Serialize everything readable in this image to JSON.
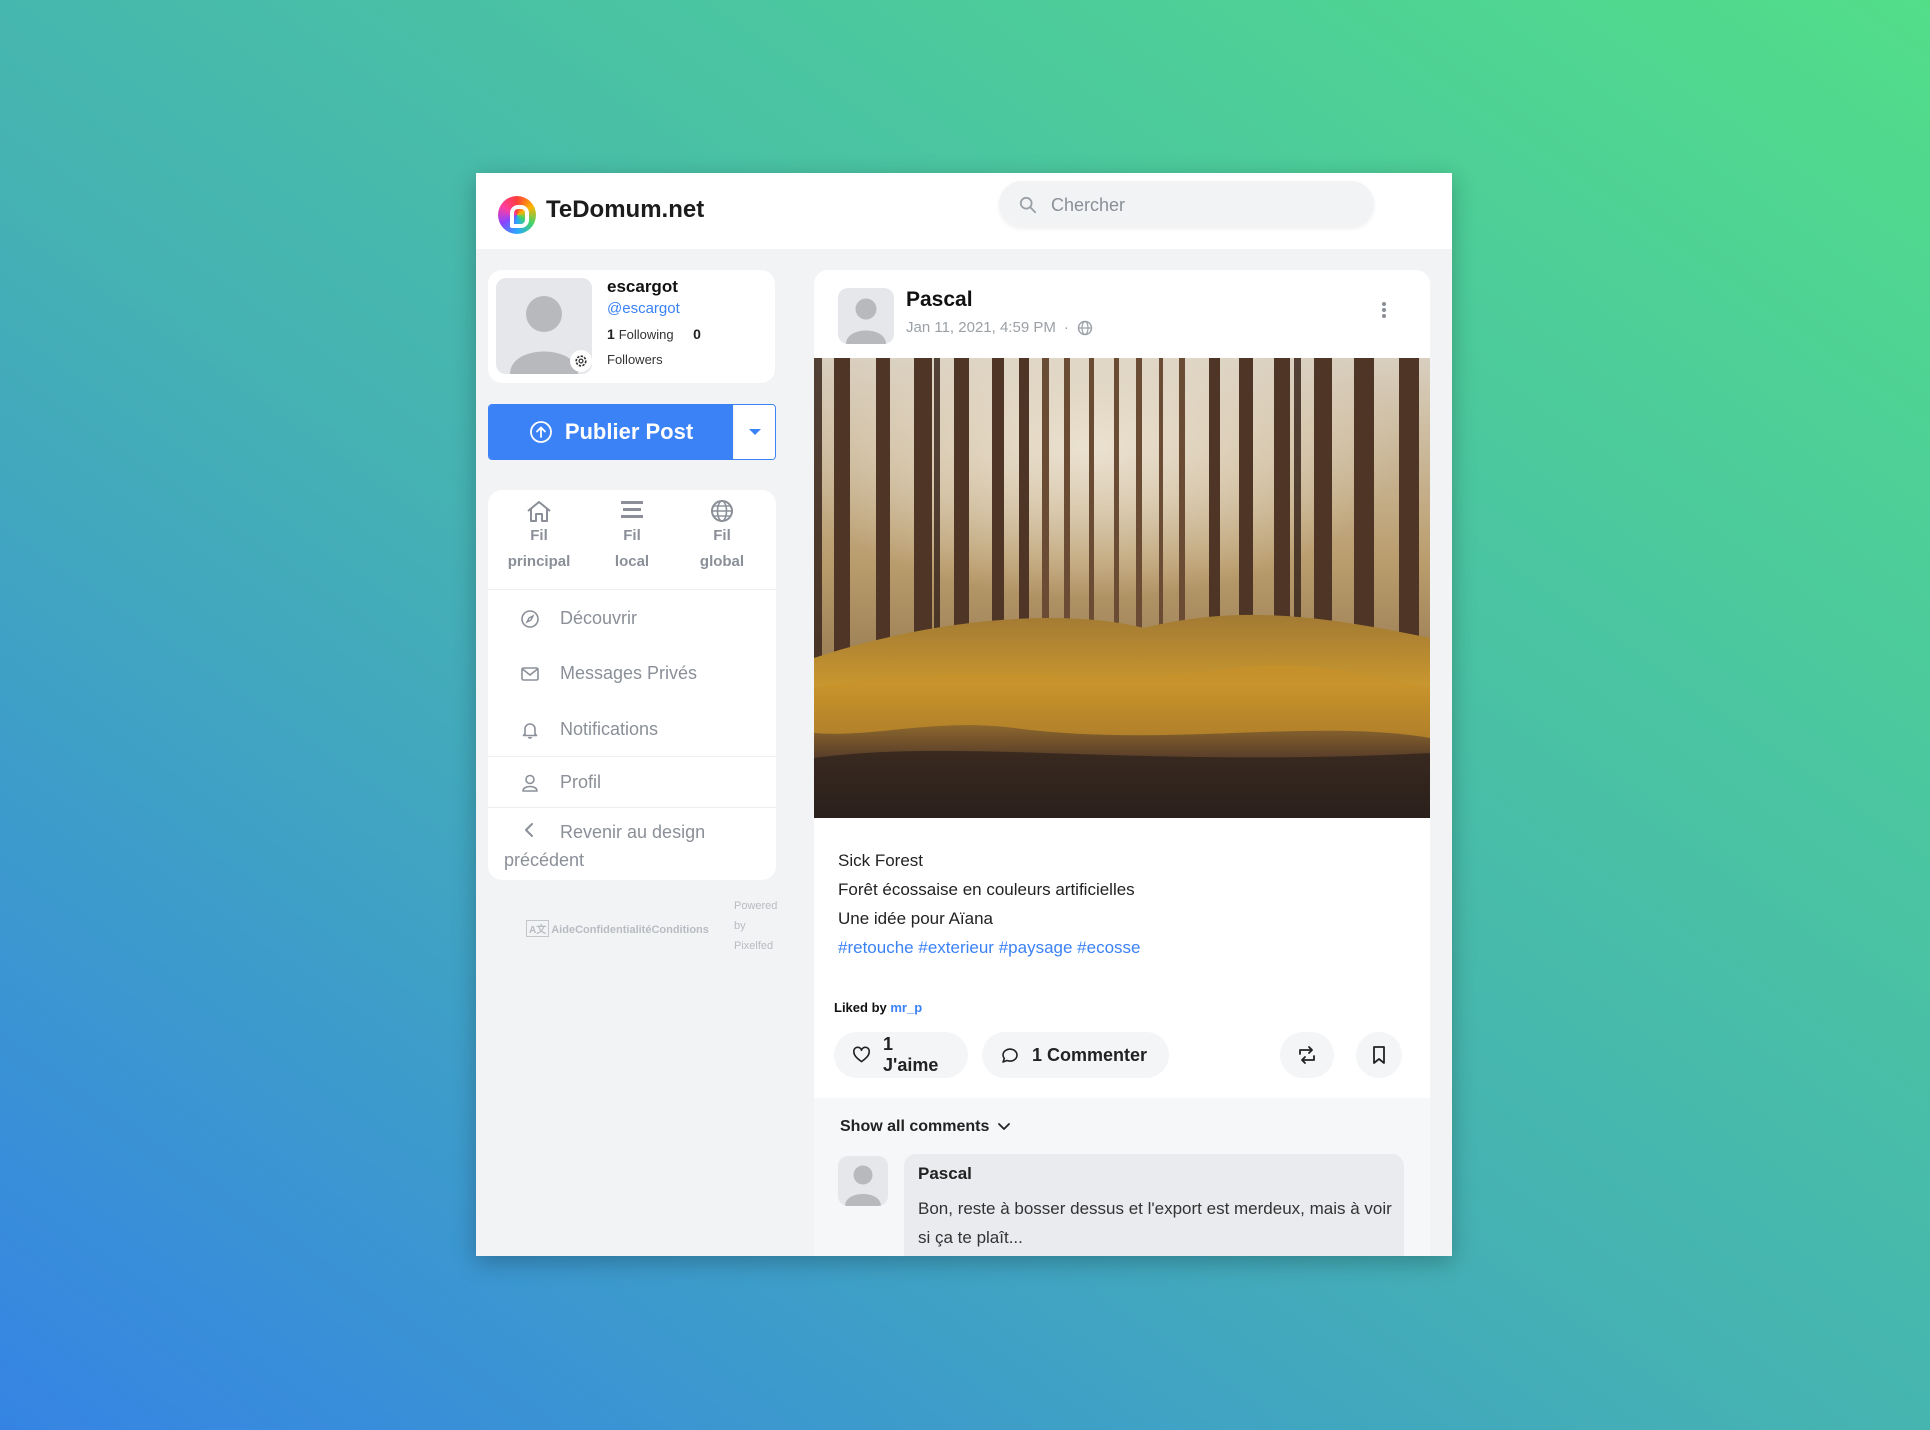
{
  "header": {
    "brand": "TeDomum.net",
    "search_placeholder": "Chercher"
  },
  "profile": {
    "name": "escargot",
    "handle": "@escargot",
    "following_count": "1",
    "following_label": "Following",
    "followers_count": "0",
    "followers_label": "Followers"
  },
  "publish": {
    "label": "Publier Post"
  },
  "feeds": [
    {
      "line1": "Fil",
      "line2": "principal",
      "icon": "home-icon"
    },
    {
      "line1": "Fil",
      "line2": "local",
      "icon": "list-icon"
    },
    {
      "line1": "Fil",
      "line2": "global",
      "icon": "globe-icon"
    }
  ],
  "menu": {
    "discover": "Découvrir",
    "messages": "Messages Privés",
    "notifications": "Notifications",
    "profile": "Profil",
    "back_line1": "Revenir au design",
    "back_line2": "précédent"
  },
  "footer": {
    "links": "AideConfidentialitéConditions",
    "powered": "Powered",
    "by": "by",
    "pixelfed": "Pixelfed"
  },
  "post": {
    "author": "Pascal",
    "timestamp": "Jan 11, 2021, 4:59 PM",
    "separator": "·",
    "caption": [
      "Sick Forest",
      "Forêt écossaise en couleurs artificielles",
      "Une idée pour Aïana"
    ],
    "hashtags": [
      "#retouche",
      "#exterieur",
      "#paysage",
      "#ecosse"
    ],
    "liked_by_label": "Liked by",
    "liked_by_user": "mr_p",
    "like_label": "1 J'aime",
    "comment_label": "1 Commenter"
  },
  "comments": {
    "show_all": "Show all comments",
    "items": [
      {
        "author": "Pascal",
        "text": "Bon, reste à bosser dessus et l'export est merdeux, mais à voir si ça te plaît..."
      }
    ]
  },
  "colors": {
    "accent": "#3b82f6",
    "muted": "#8a8f98"
  }
}
